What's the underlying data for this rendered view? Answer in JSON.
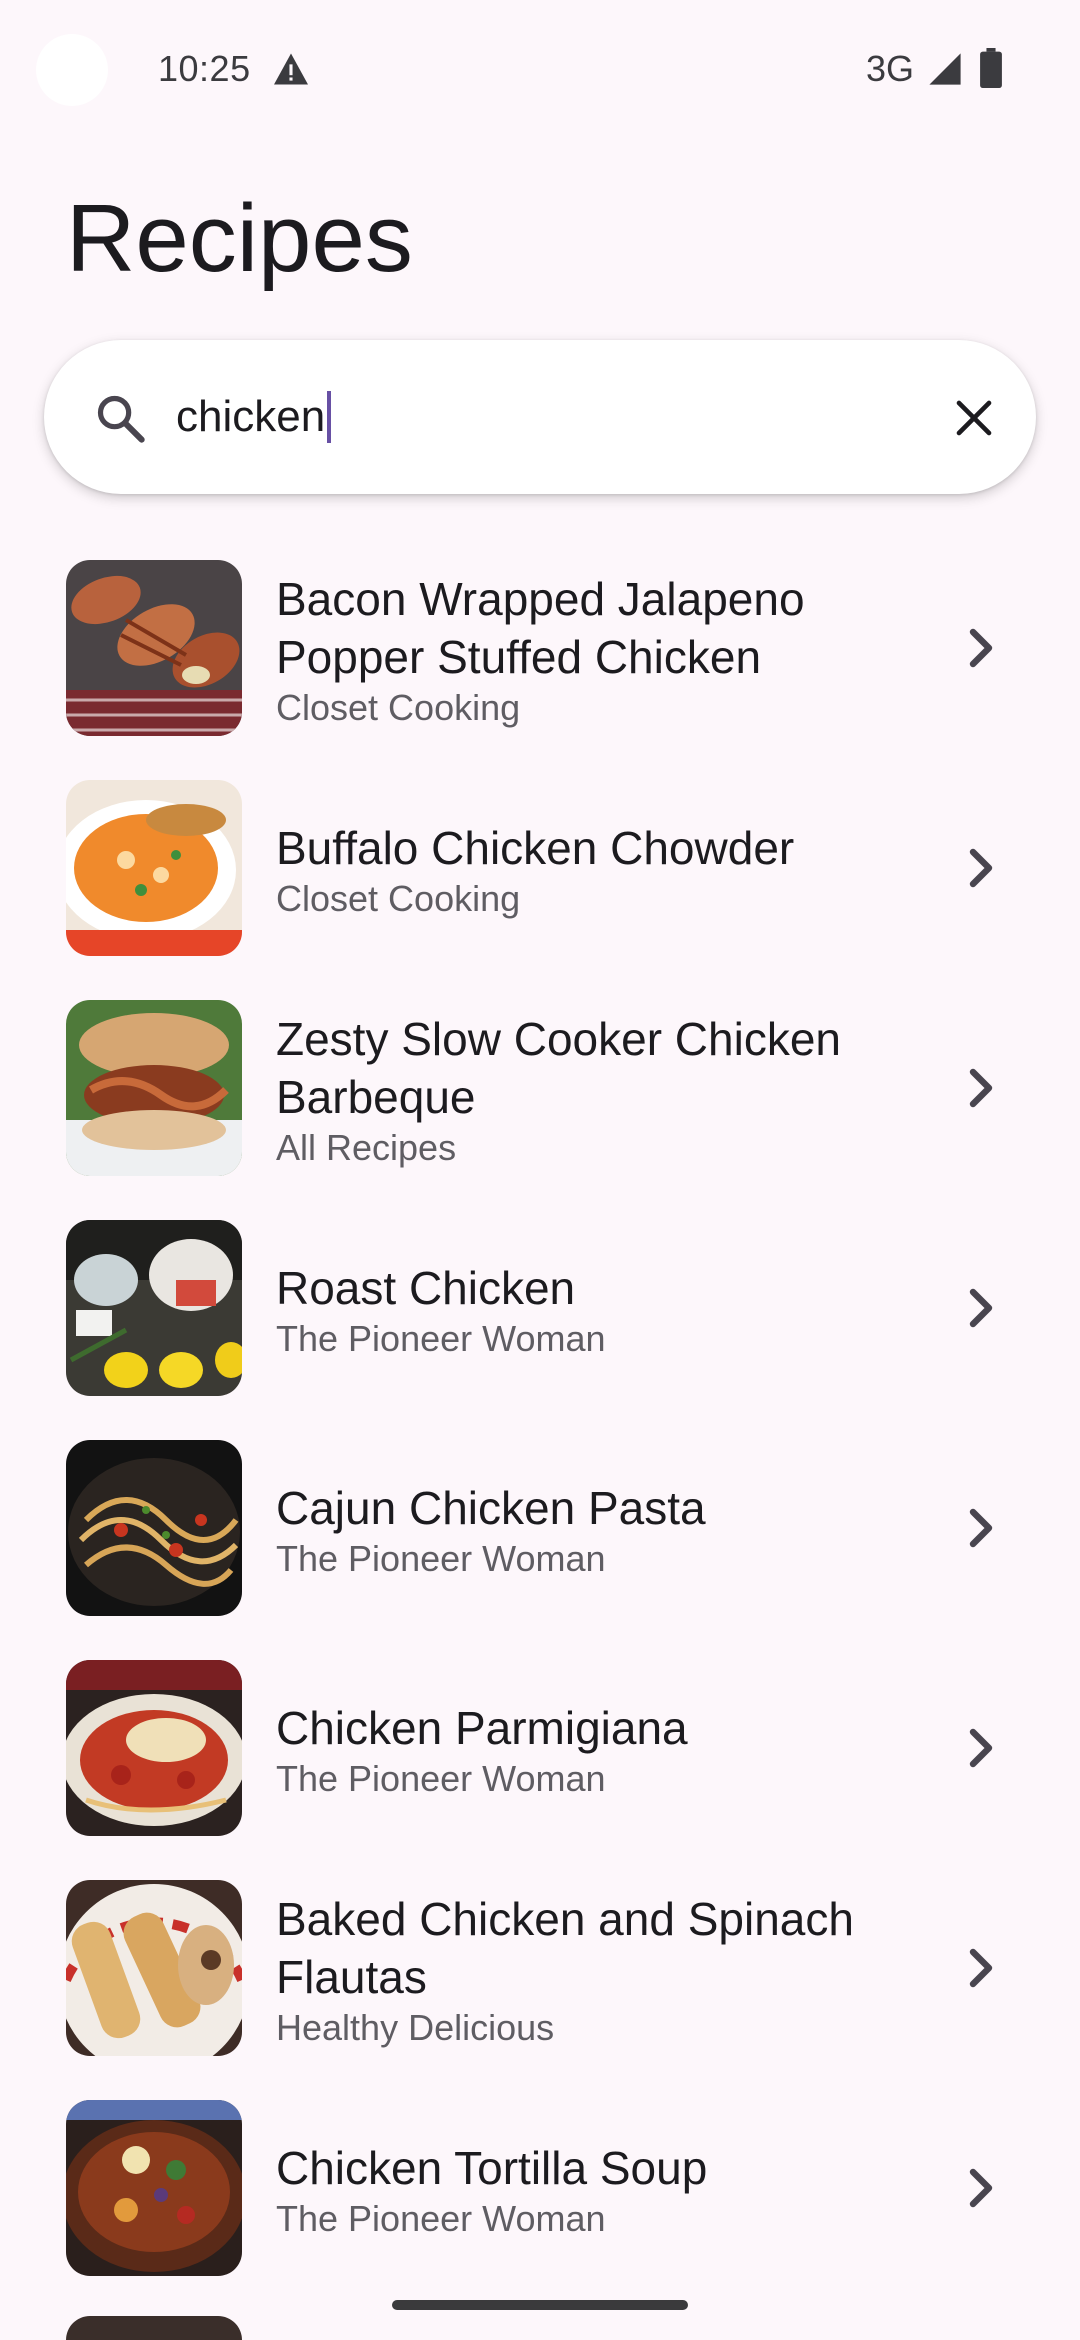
{
  "status_bar": {
    "time": "10:25",
    "network": "3G",
    "icons": [
      "warning-icon",
      "signal-icon",
      "battery-icon"
    ]
  },
  "header": {
    "title": "Recipes"
  },
  "search": {
    "value": "chicken",
    "placeholder": "",
    "search_icon": "search-icon",
    "clear_icon": "close-icon"
  },
  "recipes": [
    {
      "title": "Bacon Wrapped Jalapeno Popper Stuffed Chicken",
      "source": "Closet Cooking"
    },
    {
      "title": "Buffalo Chicken Chowder",
      "source": "Closet Cooking"
    },
    {
      "title": "Zesty Slow Cooker Chicken Barbeque",
      "source": "All Recipes"
    },
    {
      "title": "Roast Chicken",
      "source": "The Pioneer Woman"
    },
    {
      "title": "Cajun Chicken Pasta",
      "source": "The Pioneer Woman"
    },
    {
      "title": "Chicken Parmigiana",
      "source": "The Pioneer Woman"
    },
    {
      "title": "Baked Chicken and Spinach Flautas",
      "source": "Healthy Delicious"
    },
    {
      "title": "Chicken Tortilla Soup",
      "source": "The Pioneer Woman"
    }
  ],
  "colors": {
    "background": "#fdf7fb",
    "caret": "#6750a4",
    "text_primary": "#1c1b1f",
    "text_secondary": "#5f5d63"
  }
}
